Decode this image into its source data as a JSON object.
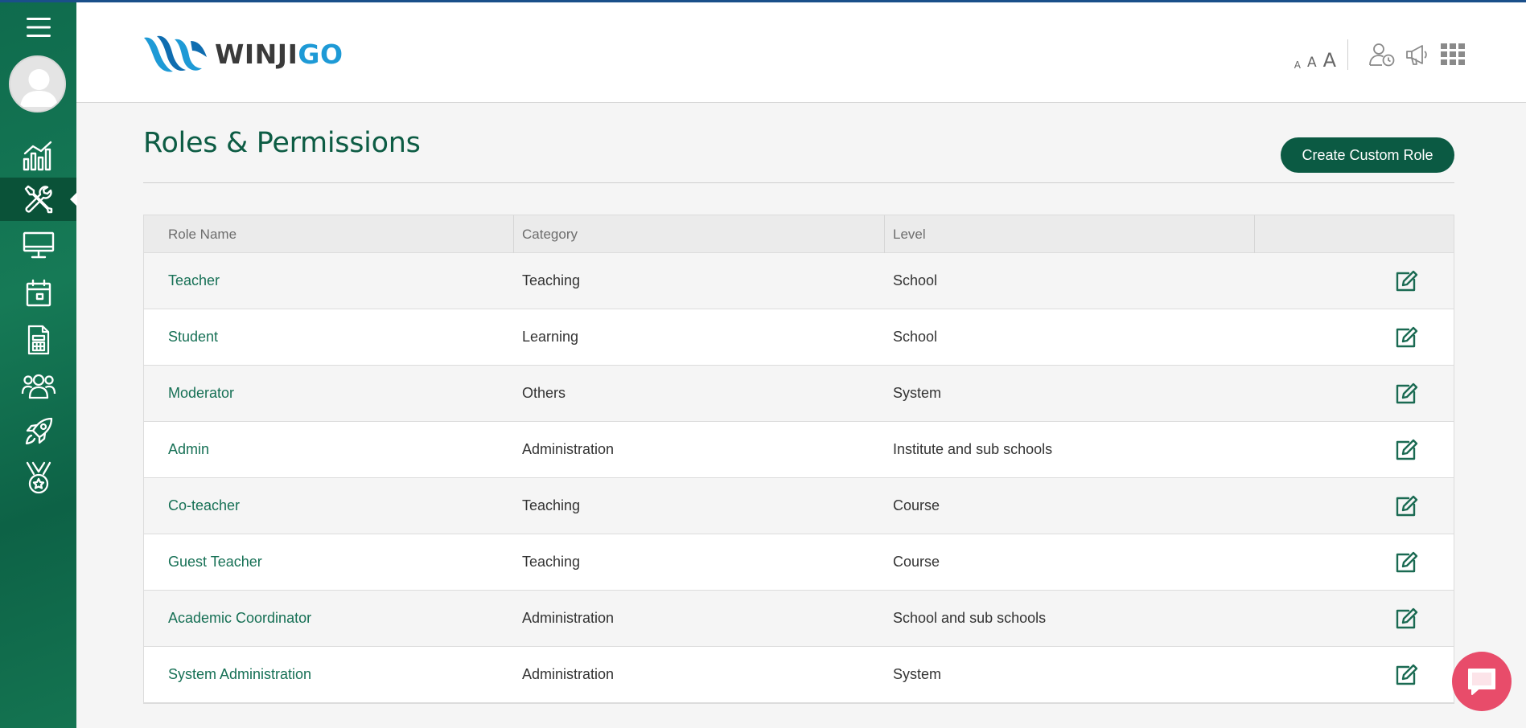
{
  "app": {
    "logo_text_dark": "WINJI",
    "logo_text_blue": "GO"
  },
  "header": {
    "font_sizes": [
      "A",
      "A",
      "A"
    ],
    "icons": [
      "user-clock-icon",
      "megaphone-icon",
      "apps-grid-icon"
    ]
  },
  "sidebar": {
    "items": [
      {
        "name": "menu",
        "icon": "hamburger-icon"
      },
      {
        "name": "profile",
        "icon": "avatar"
      },
      {
        "name": "analytics",
        "icon": "analytics-icon"
      },
      {
        "name": "tools",
        "icon": "tools-icon",
        "active": true
      },
      {
        "name": "monitor",
        "icon": "monitor-icon"
      },
      {
        "name": "calendar",
        "icon": "calendar-icon"
      },
      {
        "name": "calculator",
        "icon": "calculator-icon"
      },
      {
        "name": "users",
        "icon": "users-icon"
      },
      {
        "name": "rocket",
        "icon": "rocket-icon"
      },
      {
        "name": "badge",
        "icon": "medal-icon"
      }
    ]
  },
  "page": {
    "title": "Roles & Permissions",
    "create_button": "Create Custom Role"
  },
  "table": {
    "headers": [
      "Role Name",
      "Category",
      "Level",
      ""
    ],
    "rows": [
      {
        "name": "Teacher",
        "category": "Teaching",
        "level": "School"
      },
      {
        "name": "Student",
        "category": "Learning",
        "level": "School"
      },
      {
        "name": "Moderator",
        "category": "Others",
        "level": "System"
      },
      {
        "name": "Admin",
        "category": "Administration",
        "level": "Institute and sub schools"
      },
      {
        "name": "Co-teacher",
        "category": "Teaching",
        "level": "Course"
      },
      {
        "name": "Guest Teacher",
        "category": "Teaching",
        "level": "Course"
      },
      {
        "name": "Academic Coordinator",
        "category": "Administration",
        "level": "School and sub schools"
      },
      {
        "name": "System Administration",
        "category": "Administration",
        "level": "System"
      }
    ]
  },
  "colors": {
    "sidebar": "#0f6b4d",
    "accent": "#0b5a43",
    "link": "#167055",
    "chat": "#e84c6a",
    "logo_blue": "#1e9ad6"
  }
}
